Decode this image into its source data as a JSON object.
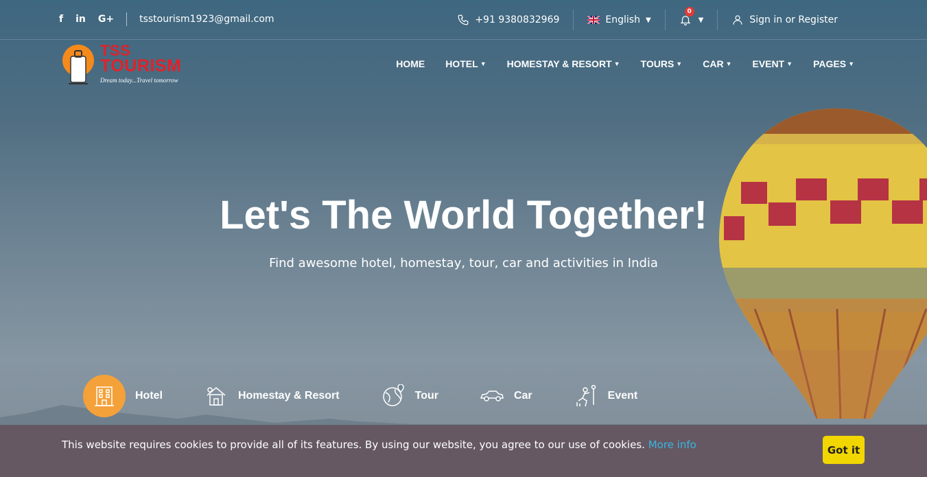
{
  "topbar": {
    "social": [
      {
        "icon": "facebook-icon",
        "glyph": "f"
      },
      {
        "icon": "linkedin-icon",
        "glyph": "in"
      },
      {
        "icon": "google-plus-icon",
        "glyph": "G+"
      }
    ],
    "email": "tsstourism1923@gmail.com",
    "phone": "+91 9380832969",
    "language": "English",
    "notification_count": "0",
    "signin_label": "Sign in or Register"
  },
  "logo": {
    "line1": "TSS",
    "line2": "TOURISM",
    "tagline": "Dream today...Travel tomorrow"
  },
  "nav": {
    "items": [
      {
        "label": "HOME",
        "dropdown": false
      },
      {
        "label": "HOTEL",
        "dropdown": true
      },
      {
        "label": "HOMESTAY & RESORT",
        "dropdown": true
      },
      {
        "label": "TOURS",
        "dropdown": true
      },
      {
        "label": "CAR",
        "dropdown": true
      },
      {
        "label": "EVENT",
        "dropdown": true
      },
      {
        "label": "PAGES",
        "dropdown": true
      }
    ]
  },
  "hero": {
    "title": "Let's The World Together!",
    "subtitle": "Find awesome hotel, homestay, tour, car and activities in India"
  },
  "categories": [
    {
      "label": "Hotel",
      "icon": "hotel-building-icon",
      "active": true
    },
    {
      "label": "Homestay & Resort",
      "icon": "house-icon",
      "active": false
    },
    {
      "label": "Tour",
      "icon": "globe-pin-icon",
      "active": false
    },
    {
      "label": "Car",
      "icon": "car-icon",
      "active": false
    },
    {
      "label": "Event",
      "icon": "climber-icon",
      "active": false
    }
  ],
  "cookie": {
    "text": "This website requires cookies to provide all of its features. By using our website, you agree to our use of cookies.",
    "link": "More info",
    "button": "Got it"
  },
  "colors": {
    "accent": "#f4a13a",
    "brand_red": "#e0222a",
    "cookie_bg": "#655863",
    "cookie_button": "#f1d600",
    "link": "#3ab6e0",
    "badge": "#e53935"
  }
}
